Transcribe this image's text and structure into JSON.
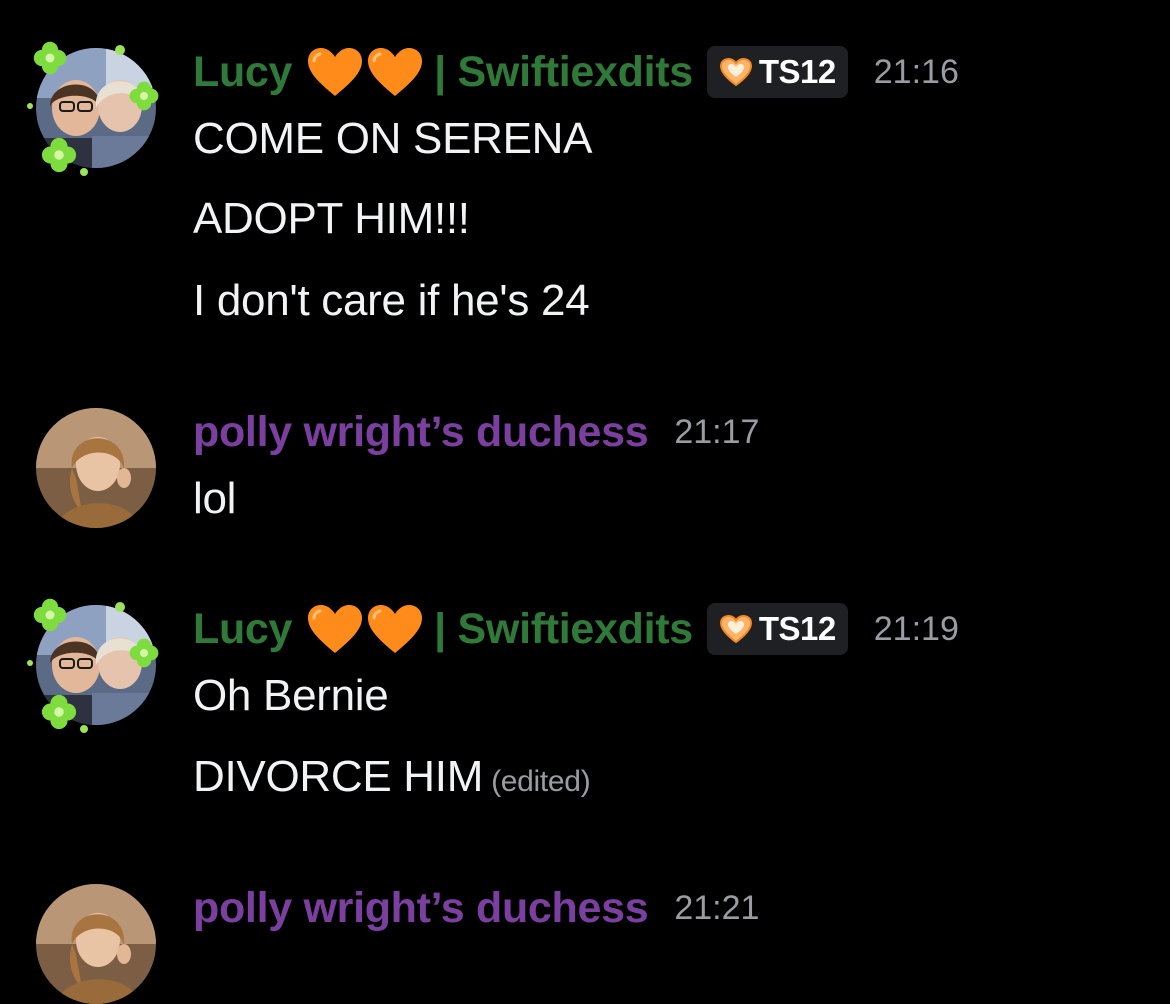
{
  "messages": [
    {
      "author": "Lucy",
      "author_suffix": "| Swiftiexdits",
      "tag": "TS12",
      "time": "21:16",
      "lines": [
        "COME ON SERENA",
        "ADOPT HIM!!!",
        "I don't care if he's 24"
      ]
    },
    {
      "author": "polly wright’s duchess",
      "time": "21:17",
      "lines": [
        "lol"
      ]
    },
    {
      "author": "Lucy",
      "author_suffix": "| Swiftiexdits",
      "tag": "TS12",
      "time": "21:19",
      "lines": [
        "Oh Bernie",
        "DIVORCE HIM"
      ],
      "edited_label": "(edited)"
    },
    {
      "author": "polly wright’s duchess",
      "time": "21:21"
    }
  ],
  "colors": {
    "background": "#000000",
    "lucy_name": "#2f7a38",
    "polly_name": "#7b3fa0",
    "heart": "#ff8c1a",
    "timestamp": "#9a9ca3",
    "tag_bg": "#1f2023"
  },
  "icons": {
    "heart": "orange-heart-icon",
    "tag": "orange-heart-badge-icon",
    "decoration": "clover-flower-decoration-icon"
  }
}
